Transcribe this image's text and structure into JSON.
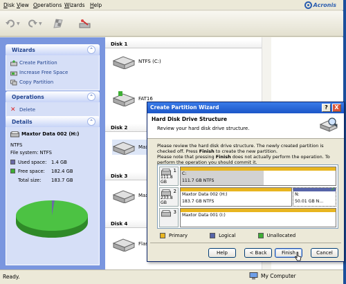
{
  "menu": [
    "Disk",
    "View",
    "Operations",
    "Wizards",
    "Help"
  ],
  "brand": "Acronis",
  "sidebar": {
    "wizards": {
      "title": "Wizards",
      "items": [
        "Create Partition",
        "Increase Free Space",
        "Copy Partition"
      ]
    },
    "operations": {
      "title": "Operations",
      "items": [
        "Delete"
      ]
    },
    "details": {
      "title": "Details",
      "name": "Maxtor Data 002 (H:)",
      "fs": "NTFS",
      "fs_line": "File system: NTFS",
      "used_label": "Used space:",
      "used_value": "1.4 GB",
      "free_label": "Free space:",
      "free_value": "182.4 GB",
      "total_label": "Total size:",
      "total_value": "183.7 GB",
      "used_fraction": 0.0076
    }
  },
  "content": {
    "disks": [
      {
        "label": "Disk 1"
      },
      {
        "label": "Disk 2"
      },
      {
        "label": "Disk 3"
      },
      {
        "label": "Disk 4"
      }
    ],
    "partitions": [
      "NTFS (C:)",
      "FAT16",
      "Maxtor",
      "Maxtor",
      "FlashD"
    ]
  },
  "status": {
    "left": "Ready.",
    "right": "My Computer"
  },
  "wizard": {
    "title": "Create Partition Wizard",
    "help_glyph": "?",
    "close_glyph": "X",
    "heading": "Hard Disk Drive Structure",
    "subheading": "Review your hard disk drive structure.",
    "description_1": "Please review the hard disk drive structure. The newly created partition is checked off. Press ",
    "description_bold_1": "Finish",
    "description_2": " to create the new partition.",
    "description_3": "Please note that pressing ",
    "description_bold_2": "Finish",
    "description_4": " does not actually perform the operation. To perform the operation you should commit it.",
    "map": [
      {
        "num": "1",
        "size": "111.8 GB",
        "segments": [
          {
            "line1": "C:",
            "line2": "111.7 GB  NTFS",
            "type": "primary"
          }
        ]
      },
      {
        "num": "2",
        "size": "233.8 GB",
        "segments": [
          {
            "line1": "Maxtor Data 002 (H:)",
            "line2": "183.7 GB  NTFS",
            "type": "primary"
          },
          {
            "line1": "N:",
            "line2": "50.01 GB  N...",
            "type": "logical",
            "checked": true
          }
        ]
      },
      {
        "num": "3",
        "size": "",
        "segments": [
          {
            "line1": "Maxtor Data 001 (I:)",
            "line2": "",
            "type": "primary"
          }
        ]
      }
    ],
    "legend": [
      "Primary",
      "Logical",
      "Unallocated"
    ],
    "buttons": {
      "help": "Help",
      "back": "< Back",
      "finish": "Finish",
      "cancel": "Cancel"
    }
  },
  "colors": {
    "primary": "#e8b520",
    "logical": "#5664a8",
    "unallocated": "#3fae35",
    "used": "#6a6aa8",
    "free": "#3fae35"
  }
}
